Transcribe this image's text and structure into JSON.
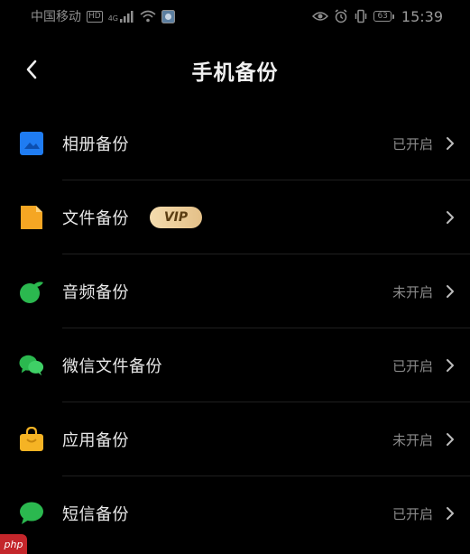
{
  "status_bar": {
    "carrier": "中国移动",
    "hd": "HD",
    "network": "4G",
    "battery": "63",
    "time": "15:39"
  },
  "header": {
    "title": "手机备份"
  },
  "items": [
    {
      "label": "相册备份",
      "status": "已开启",
      "icon": "photo-icon",
      "color": "#1f7cf2"
    },
    {
      "label": "文件备份",
      "badge": "VIP",
      "status": "",
      "icon": "file-icon",
      "color": "#f5a623"
    },
    {
      "label": "音频备份",
      "status": "未开启",
      "icon": "music-icon",
      "color": "#2bb84f"
    },
    {
      "label": "微信文件备份",
      "status": "已开启",
      "icon": "wechat-icon",
      "color": "#2bb84f"
    },
    {
      "label": "应用备份",
      "status": "未开启",
      "icon": "app-bag-icon",
      "color": "#f5b324"
    },
    {
      "label": "短信备份",
      "status": "已开启",
      "icon": "sms-icon",
      "color": "#2bb84f"
    }
  ],
  "watermark": "php"
}
